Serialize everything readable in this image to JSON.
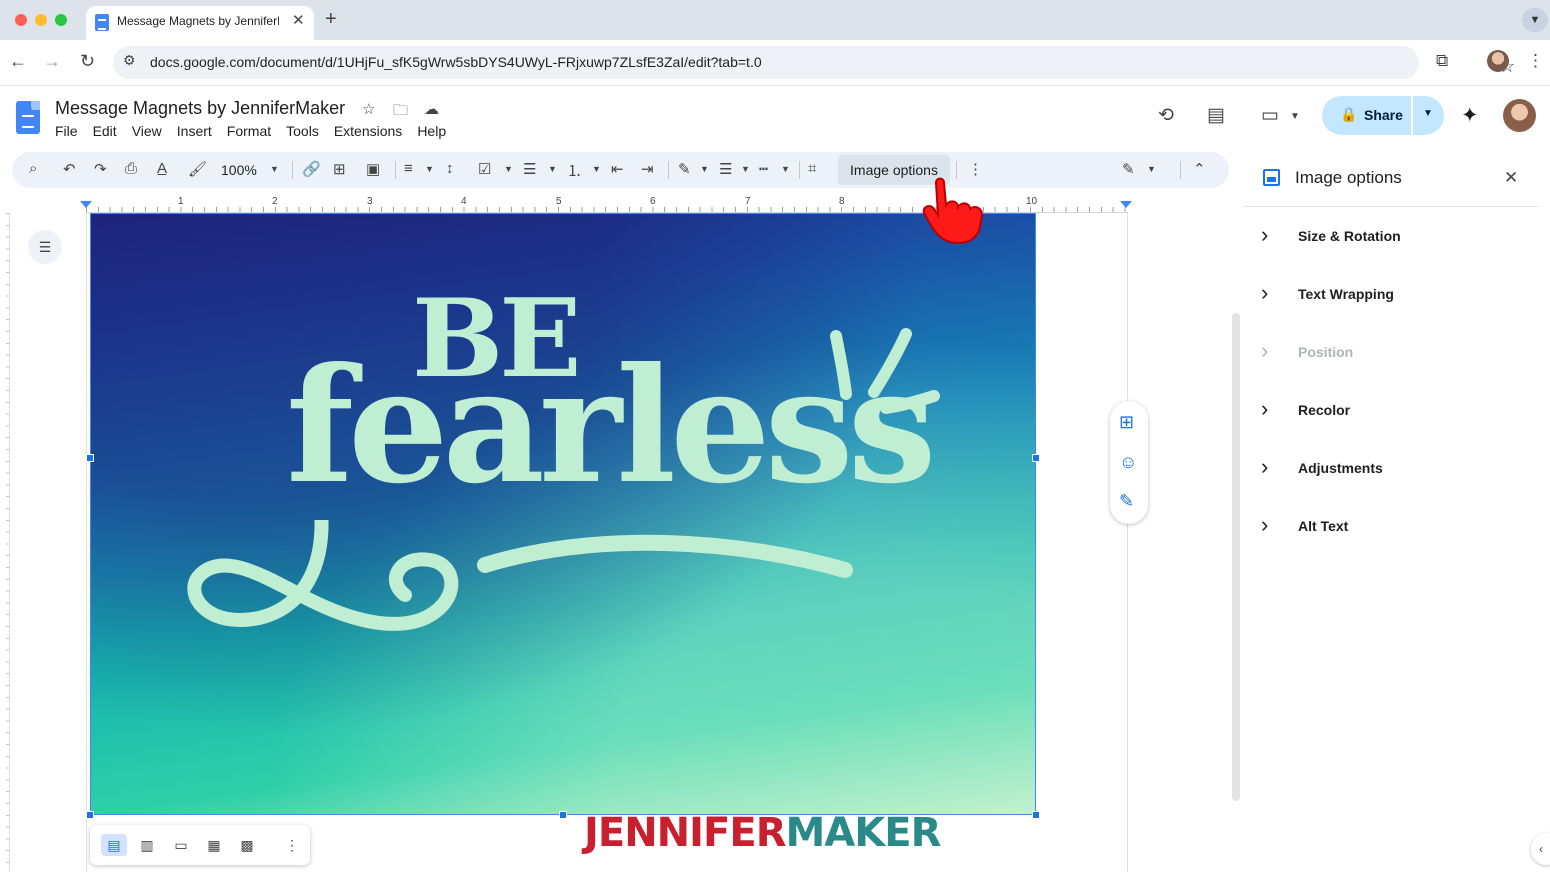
{
  "browser": {
    "tab_title": "Message Magnets by JenniferMaker",
    "url": "docs.google.com/document/d/1UHjFu_sfK5gWrw5sbDYS4UWyL-FRjxuwp7ZLsfE3ZaI/edit?tab=t.0"
  },
  "doc": {
    "title": "Message Magnets by JenniferMaker",
    "menu": [
      "File",
      "Edit",
      "View",
      "Insert",
      "Format",
      "Tools",
      "Extensions",
      "Help"
    ],
    "share_label": "Share"
  },
  "toolbar": {
    "zoom": "100%",
    "image_options_label": "Image options"
  },
  "ruler": {
    "numbers": [
      "1",
      "2",
      "3",
      "4",
      "5",
      "6",
      "7",
      "8",
      "10"
    ]
  },
  "image": {
    "line1": "BE",
    "line2": "fearless"
  },
  "watermark": {
    "part1": "JENNIFER",
    "part2": "MAKER"
  },
  "panel": {
    "title": "Image options",
    "items": [
      {
        "label": "Size & Rotation",
        "enabled": true
      },
      {
        "label": "Text Wrapping",
        "enabled": true
      },
      {
        "label": "Position",
        "enabled": false
      },
      {
        "label": "Recolor",
        "enabled": true
      },
      {
        "label": "Adjustments",
        "enabled": true
      },
      {
        "label": "Alt Text",
        "enabled": true
      }
    ]
  },
  "colors": {
    "accent": "#1a73e8",
    "share_bg": "#c2e7ff",
    "toolbar_bg": "#edf2fa",
    "image_text": "#bfeed2",
    "watermark_red": "#c8202f",
    "watermark_teal": "#2a8a8a"
  },
  "icons": {
    "search": "search-icon",
    "undo": "undo-icon",
    "redo": "redo-icon",
    "print": "print-icon",
    "spellcheck": "spellcheck-icon",
    "paint_format": "paint-format-icon",
    "link": "link-icon",
    "comment": "add-comment-icon",
    "image": "insert-image-icon",
    "crop": "crop-icon",
    "history": "history-icon",
    "comments": "comments-icon",
    "meet": "video-call-icon",
    "lock": "lock-icon",
    "gemini": "gemini-icon"
  }
}
